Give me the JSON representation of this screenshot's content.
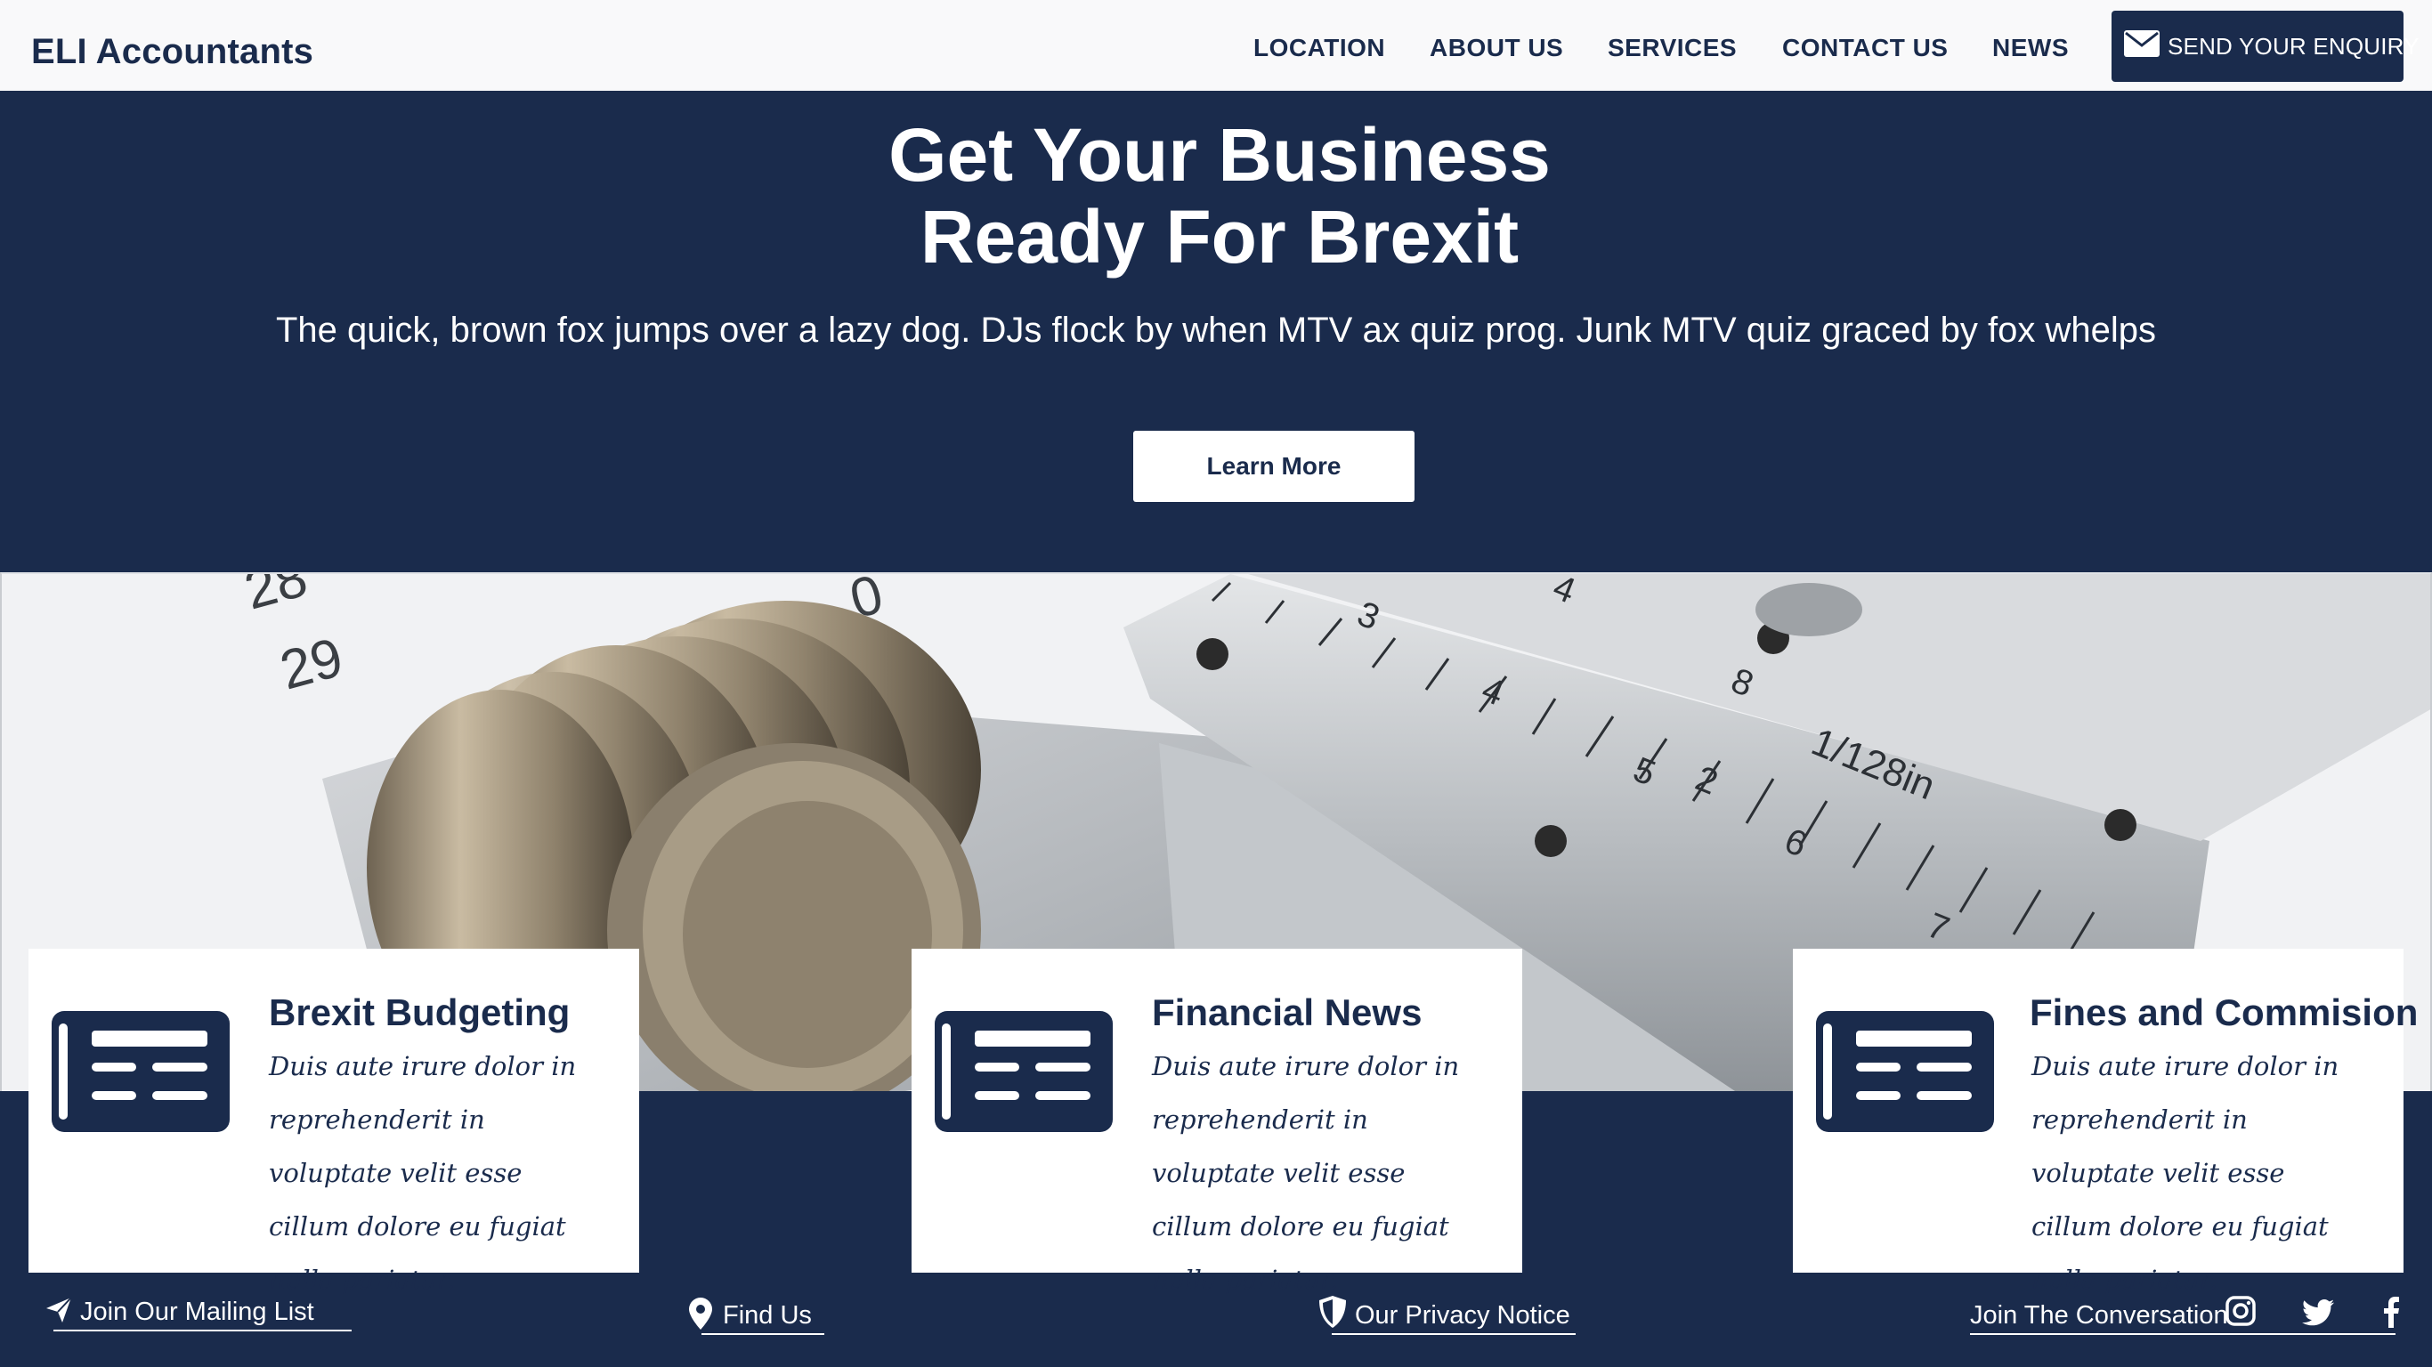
{
  "header": {
    "brand": "ELI Accountants",
    "nav": [
      "LOCATION",
      "ABOUT US",
      "SERVICES",
      "CONTACT US",
      "NEWS"
    ],
    "cta_label": "SEND YOUR ENQUIRY"
  },
  "hero": {
    "title_line1": "Get Your Business",
    "title_line2": "Ready For Brexit",
    "subtitle": "The quick, brown fox jumps over a lazy dog. DJs flock by when MTV ax quiz prog. Junk MTV quiz graced by fox whelps",
    "button": "Learn More"
  },
  "cards": [
    {
      "title": "Brexit Budgeting",
      "text": "Duis aute irure dolor in reprehenderit in voluptate velit esse cillum dolore eu fugiat nulla pariatur.",
      "icon": "newspaper-icon"
    },
    {
      "title": "Financial News",
      "text": "Duis aute irure dolor in reprehenderit in voluptate velit esse cillum dolore eu fugiat nulla pariatur.",
      "icon": "newspaper-icon"
    },
    {
      "title": "Fines and Commision",
      "text": "Duis aute irure dolor in reprehenderit in voluptate velit esse cillum dolore eu fugiat nulla pariatur.",
      "icon": "newspaper-icon"
    }
  ],
  "footer": {
    "mailing": "Join Our Mailing List",
    "find": "Find Us",
    "privacy": "Our Privacy Notice",
    "conversation": "Join The Conversation",
    "social_icons": [
      "instagram-icon",
      "twitter-icon",
      "facebook-icon"
    ]
  },
  "colors": {
    "navy": "#1a2b4c",
    "white": "#ffffff",
    "header_bg": "#f9f9fa"
  }
}
